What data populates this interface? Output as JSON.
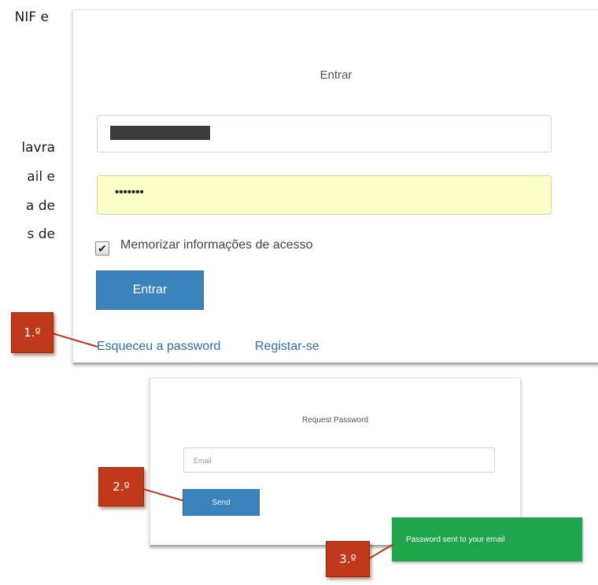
{
  "document_fragment": {
    "lines": [
      "NIF e",
      "lavra",
      "ail e",
      "a de",
      "s de"
    ]
  },
  "login": {
    "title": "Entrar",
    "password_dots": "•••••••",
    "remember_label": "Memorizar informações de acesso",
    "remember_checked": "✔",
    "submit_label": "Entrar",
    "forgot_link": "Esqueceu a password",
    "register_link": "Registar-se"
  },
  "request_password": {
    "title": "Request Password",
    "email_placeholder": "Email",
    "send_label": "Send"
  },
  "toast": {
    "message": "Password sent to your email",
    "color": "#1fa54b"
  },
  "callouts": [
    "1.º",
    "2.º",
    "3.º"
  ],
  "colors": {
    "primary_button": "#3b83bd",
    "callout": "#c0391b",
    "autofill": "#fafdc4"
  }
}
